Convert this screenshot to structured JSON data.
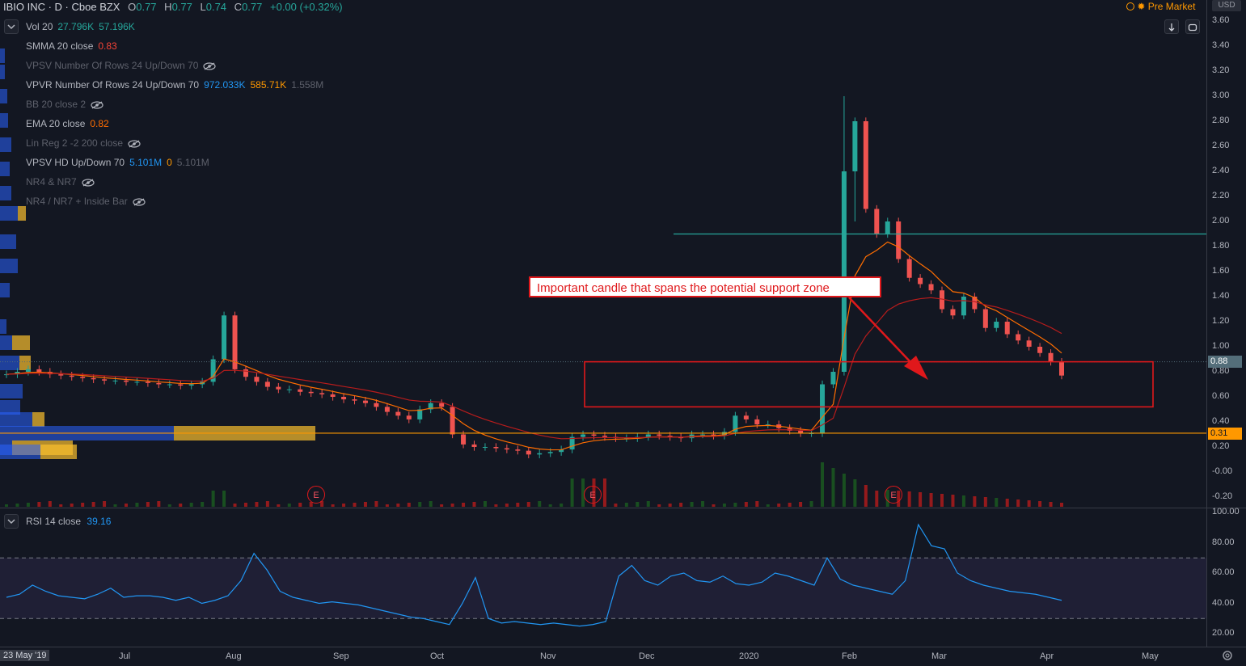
{
  "header": {
    "symbol": "IBIO INC · D · Cboe BZX",
    "open_label": "O",
    "open": "0.77",
    "high_label": "H",
    "high": "0.77",
    "low_label": "L",
    "low": "0.74",
    "close_label": "C",
    "close": "0.77",
    "change": "+0.00 (+0.32%)",
    "premarket": "Pre Market",
    "currency": "USD"
  },
  "indicators": [
    {
      "name": "Vol 20",
      "v1": "27.796K",
      "v2": "57.196K",
      "hidden": false
    },
    {
      "name": "SMMA 20 close",
      "v1": "0.83",
      "hidden": false
    },
    {
      "name": "VPSV Number Of Rows 24 Up/Down 70",
      "hidden": true
    },
    {
      "name": "VPVR Number Of Rows 24 Up/Down 70",
      "v1": "972.033K",
      "v2": "585.71K",
      "v3": "1.558M",
      "hidden": false
    },
    {
      "name": "BB 20 close 2",
      "hidden": true
    },
    {
      "name": "EMA 20 close",
      "v1": "0.82",
      "hidden": false
    },
    {
      "name": "Lin Reg 2 -2 200 close",
      "hidden": true
    },
    {
      "name": "VPSV HD Up/Down 70",
      "v1": "5.101M",
      "v2": "0",
      "v3": "5.101M",
      "hidden": false
    },
    {
      "name": "NR4 & NR7",
      "hidden": true
    },
    {
      "name": "NR4 / NR7 + Inside Bar",
      "hidden": true
    }
  ],
  "rsi_legend": {
    "name": "RSI 14 close",
    "value": "39.16"
  },
  "annotation": "Important candle that spans the potential support zone",
  "price_axis": [
    "3.60",
    "3.40",
    "3.20",
    "3.00",
    "2.80",
    "2.60",
    "2.40",
    "2.20",
    "2.00",
    "1.80",
    "1.60",
    "1.40",
    "1.20",
    "1.00",
    "0.80",
    "0.60",
    "0.40",
    "0.20",
    "-0.00",
    "-0.20"
  ],
  "price_tags": {
    "last": "0.88",
    "level": "0.31"
  },
  "rsi_axis": [
    "100.00",
    "80.00",
    "60.00",
    "40.00",
    "20.00"
  ],
  "time_axis": {
    "start": "23 May '19",
    "labels": [
      "Jul",
      "Aug",
      "Sep",
      "Oct",
      "Nov",
      "Dec",
      "2020",
      "Feb",
      "Mar",
      "Apr",
      "May"
    ]
  },
  "earnings_marker": "E",
  "colors": {
    "up": "#26a69a",
    "down": "#ef5350",
    "ema": "#ff6d00",
    "smma": "#b71c1c",
    "rsi": "#2196f3",
    "level": "#ff9800",
    "resistance": "#26a69a",
    "box": "#e0181b"
  },
  "chart_data": {
    "type": "candlestick",
    "ylim": [
      -0.2,
      3.6
    ],
    "closes": [
      0.78,
      0.8,
      0.82,
      0.8,
      0.78,
      0.77,
      0.76,
      0.75,
      0.74,
      0.73,
      0.73,
      0.72,
      0.72,
      0.71,
      0.7,
      0.7,
      0.69,
      0.7,
      0.72,
      0.9,
      1.25,
      0.82,
      0.76,
      0.72,
      0.68,
      0.66,
      0.66,
      0.64,
      0.63,
      0.62,
      0.6,
      0.58,
      0.57,
      0.55,
      0.52,
      0.48,
      0.45,
      0.42,
      0.5,
      0.55,
      0.52,
      0.3,
      0.22,
      0.2,
      0.2,
      0.19,
      0.18,
      0.17,
      0.14,
      0.15,
      0.16,
      0.18,
      0.28,
      0.3,
      0.29,
      0.28,
      0.27,
      0.27,
      0.28,
      0.3,
      0.29,
      0.28,
      0.27,
      0.3,
      0.3,
      0.29,
      0.32,
      0.45,
      0.42,
      0.38,
      0.38,
      0.35,
      0.33,
      0.31,
      0.31,
      0.7,
      0.8,
      2.4,
      2.8,
      2.1,
      1.9,
      2.0,
      1.7,
      1.55,
      1.5,
      1.45,
      1.3,
      1.25,
      1.4,
      1.3,
      1.15,
      1.2,
      1.1,
      1.05,
      1.0,
      0.95,
      0.88,
      0.77
    ],
    "rsi": [
      44,
      46,
      52,
      48,
      45,
      44,
      43,
      46,
      50,
      44,
      45,
      45,
      44,
      42,
      44,
      40,
      42,
      45,
      55,
      73,
      62,
      48,
      44,
      42,
      40,
      41,
      40,
      39,
      37,
      35,
      33,
      31,
      30,
      28,
      26,
      40,
      57,
      30,
      27,
      28,
      27,
      26,
      27,
      26,
      25,
      26,
      28,
      58,
      65,
      55,
      52,
      58,
      60,
      55,
      54,
      58,
      53,
      52,
      54,
      60,
      58,
      55,
      52,
      70,
      56,
      52,
      50,
      48,
      46,
      55,
      92,
      78,
      76,
      60,
      55,
      52,
      50,
      48,
      47,
      46,
      44,
      42
    ],
    "resistance_level": 1.9,
    "support_level": 0.31,
    "zone": [
      0.52,
      0.88
    ]
  }
}
